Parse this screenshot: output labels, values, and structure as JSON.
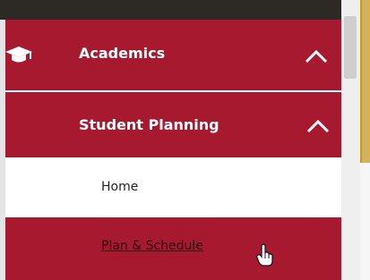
{
  "nav": {
    "academics": {
      "label": "Academics",
      "icon": "graduation-cap-icon",
      "expanded": true
    },
    "student_planning": {
      "label": "Student Planning",
      "expanded": true
    },
    "items": [
      {
        "label": "Home",
        "selected": false
      },
      {
        "label": "Plan & Schedule",
        "selected": true
      }
    ]
  },
  "colors": {
    "primary": "#a6192e",
    "header_dark": "#2d2a26",
    "gold_accent": "#d2b35d",
    "text_light": "#ffffff",
    "text_dark": "#222222"
  }
}
